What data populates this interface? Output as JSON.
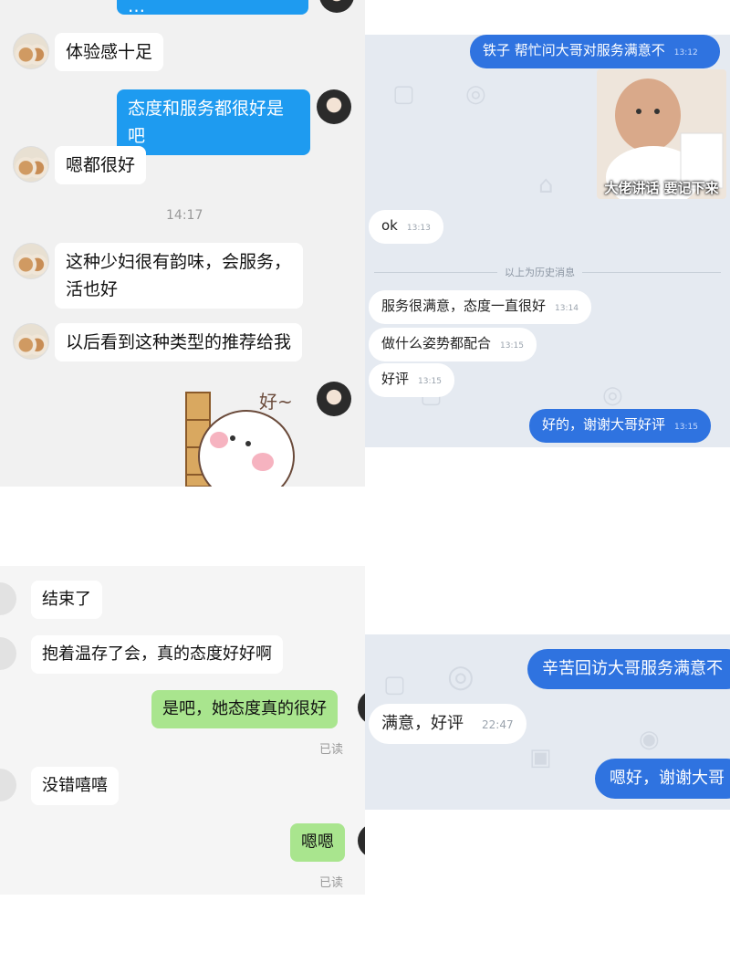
{
  "panel1": {
    "top_partial": "…",
    "m1": "体验感十足",
    "m2": "态度和服务都很好是吧",
    "m3": "嗯都很好",
    "time": "14:17",
    "m4_line1": "这种少妇很有韵味，会服务，",
    "m4_line2": "活也好",
    "m5": "以后看到这种类型的推荐给我",
    "sticker_text": "好~"
  },
  "panel2": {
    "m1": "铁子 帮忙问大哥对服务满意不",
    "t1": "13:12",
    "meme_caption": "大佬讲话 要记下来",
    "m2": "ok",
    "t2": "13:13",
    "divider": "以上为历史消息",
    "m3": "服务很满意，态度一直很好",
    "t3": "13:14",
    "m4": "做什么姿势都配合",
    "t4": "13:15",
    "m5": "好评",
    "t5": "13:15",
    "m6": "好的，谢谢大哥好评",
    "t6": "13:15"
  },
  "panel3": {
    "m1": "结束了",
    "m2": "抱着温存了会，真的态度好好啊",
    "m3": "是吧，她态度真的很好",
    "read1": "已读",
    "m4": "没错嘻嘻",
    "m5": "嗯嗯",
    "read2": "已读"
  },
  "panel4": {
    "m1": "辛苦回访大哥服务满意不",
    "m2": "满意，好评",
    "t2": "22:47",
    "m3": "嗯好，谢谢大哥"
  },
  "colors": {
    "blue_bubble": "#1e9bf0",
    "qq_blue": "#2f73e0",
    "green_bubble": "#a9e58e"
  }
}
